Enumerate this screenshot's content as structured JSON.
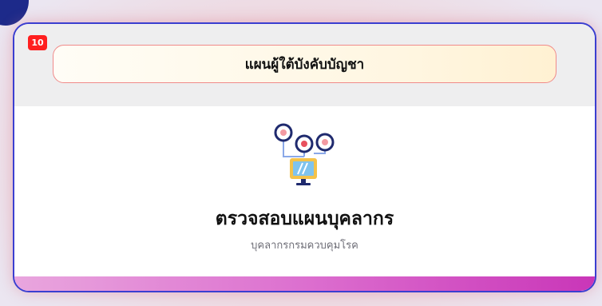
{
  "count_badge": "10",
  "header": {
    "title": "แผนผู้ใต้บังคับบัญชา"
  },
  "content": {
    "title": "ตรวจสอบแผนบุคลากร",
    "subtitle": "บุคลากรกรมควบคุมโรค",
    "illustration_icon": "org-chart-computer-icon"
  },
  "colors": {
    "card_border": "#3b3fd0",
    "badge": "#ff1f1f",
    "title_border": "#f08a8a",
    "bottom_bar_start": "#e9a6de",
    "bottom_bar_end": "#c936b8",
    "corner_badge": "#1d2a8a"
  }
}
